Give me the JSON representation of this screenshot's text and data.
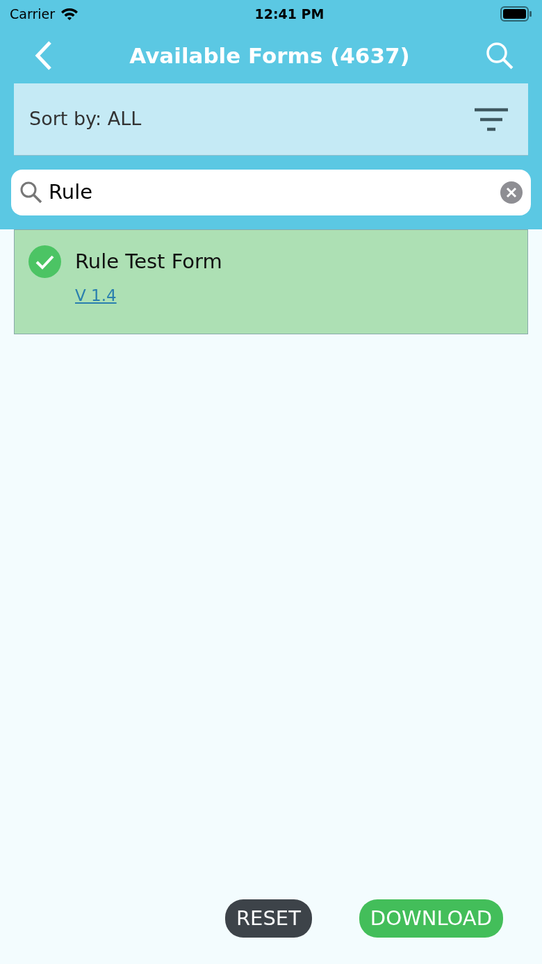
{
  "status_bar": {
    "carrier": "Carrier",
    "time": "12:41 PM"
  },
  "header": {
    "title": "Available Forms (4637)"
  },
  "sort": {
    "label": "Sort by: ALL"
  },
  "search": {
    "value": "Rule"
  },
  "forms": [
    {
      "title": "Rule Test Form",
      "version": "V 1.4",
      "selected": true
    }
  ],
  "buttons": [
    {
      "label": "RESET",
      "kind": "dark"
    },
    {
      "label": "DOWNLOAD",
      "kind": "success"
    }
  ]
}
